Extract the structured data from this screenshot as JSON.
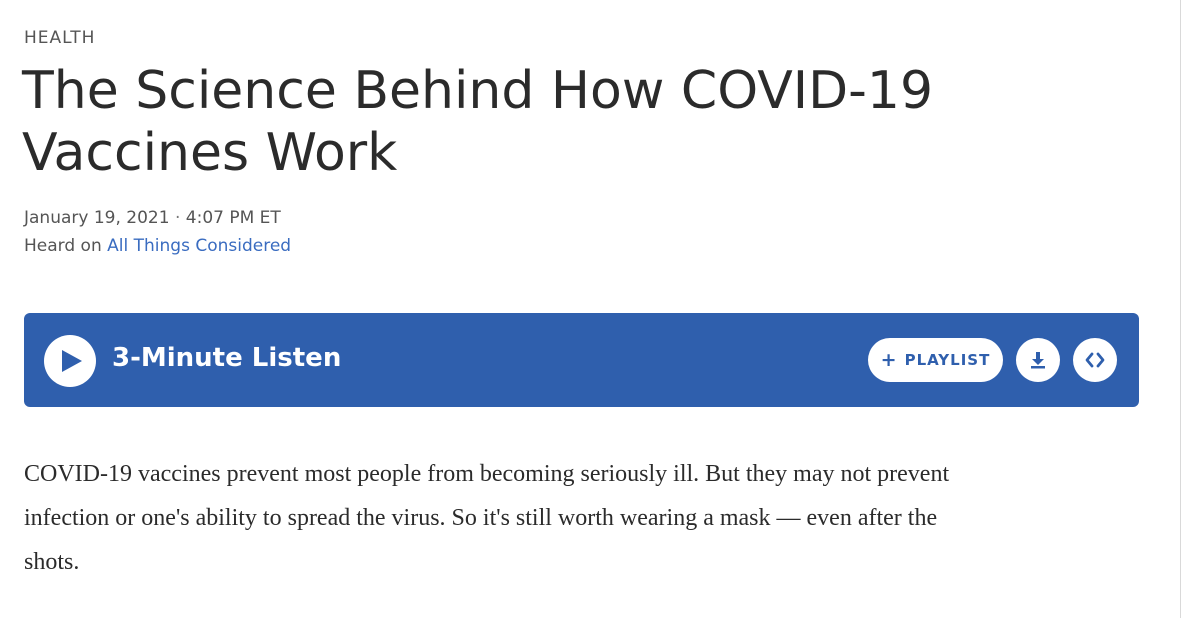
{
  "article": {
    "section": "HEALTH",
    "title": "The Science Behind How COVID-19 Vaccines Work",
    "date": "January 19, 2021",
    "date_separator": "·",
    "time": "4:07 PM ET",
    "heard_on_prefix": "Heard on",
    "program": "All Things Considered",
    "teaser": "COVID-19 vaccines prevent most people from becoming seriously ill. But they may not prevent infection or one's ability to spread the virus. So it's still worth wearing a mask — even after the shots."
  },
  "player": {
    "listen_label": "3-Minute Listen",
    "playlist_plus": "+",
    "playlist_label": "PLAYLIST",
    "icons": {
      "play": "play-icon",
      "download": "download-icon",
      "embed": "embed-icon"
    }
  },
  "colors": {
    "player_bg": "#2f5fad",
    "link": "#3a6cc0",
    "text": "#2b2b2b",
    "muted": "#555555"
  }
}
